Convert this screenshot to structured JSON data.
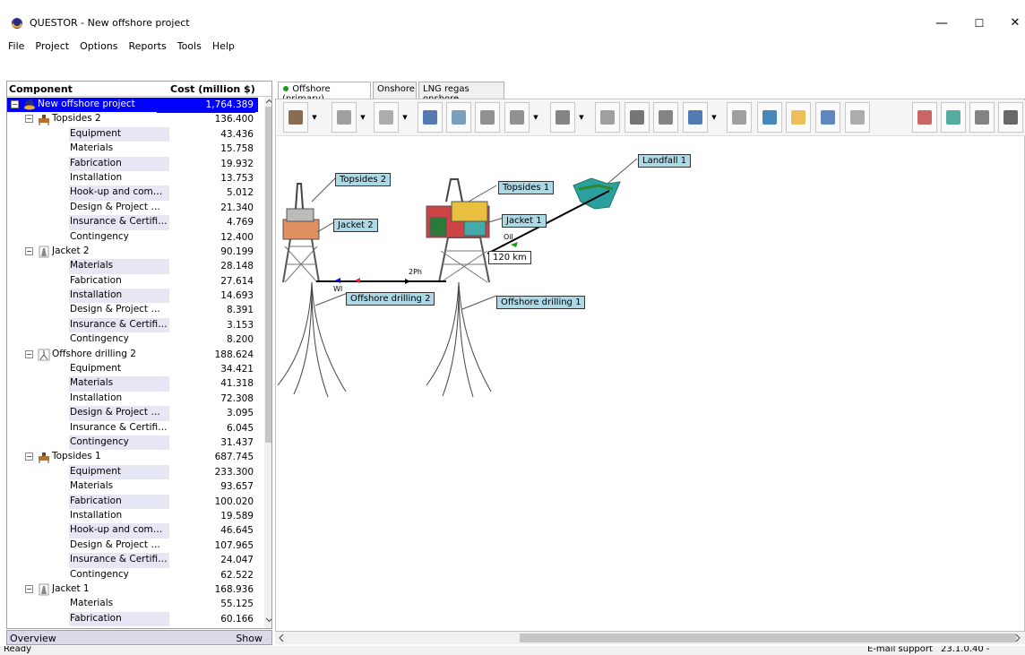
{
  "window": {
    "title": "QUESTOR - New offshore project",
    "minimize": "—",
    "maximize": "☐",
    "close": "✕"
  },
  "menu": [
    "File",
    "Project",
    "Options",
    "Reports",
    "Tools",
    "Help"
  ],
  "panel": {
    "col_component": "Component",
    "col_cost": "Cost (million $)",
    "rows": [
      {
        "name": "New offshore project",
        "cost": "1,764.389",
        "level": 0,
        "sel": true,
        "icon": "globe-icon",
        "exp": "−"
      },
      {
        "name": "Topsides 2",
        "cost": "136.400",
        "level": 1,
        "icon": "topsides-icon",
        "exp": "−"
      },
      {
        "name": "Equipment",
        "cost": "43.436",
        "level": 2,
        "alt": true
      },
      {
        "name": "Materials",
        "cost": "15.758",
        "level": 2
      },
      {
        "name": "Fabrication",
        "cost": "19.932",
        "level": 2,
        "alt": true
      },
      {
        "name": "Installation",
        "cost": "13.753",
        "level": 2
      },
      {
        "name": "Hook-up and commissi...",
        "cost": "5.012",
        "level": 2,
        "alt": true
      },
      {
        "name": "Design & Project man...",
        "cost": "21.340",
        "level": 2
      },
      {
        "name": "Insurance & Certificat...",
        "cost": "4.769",
        "level": 2,
        "alt": true
      },
      {
        "name": "Contingency",
        "cost": "12.400",
        "level": 2
      },
      {
        "name": "Jacket 2",
        "cost": "90.199",
        "level": 1,
        "icon": "jacket-icon",
        "exp": "−"
      },
      {
        "name": "Materials",
        "cost": "28.148",
        "level": 2,
        "alt": true
      },
      {
        "name": "Fabrication",
        "cost": "27.614",
        "level": 2
      },
      {
        "name": "Installation",
        "cost": "14.693",
        "level": 2,
        "alt": true
      },
      {
        "name": "Design & Project man...",
        "cost": "8.391",
        "level": 2
      },
      {
        "name": "Insurance & Certificat...",
        "cost": "3.153",
        "level": 2,
        "alt": true
      },
      {
        "name": "Contingency",
        "cost": "8.200",
        "level": 2
      },
      {
        "name": "Offshore drilling 2",
        "cost": "188.624",
        "level": 1,
        "icon": "drilling-icon",
        "exp": "−"
      },
      {
        "name": "Equipment",
        "cost": "34.421",
        "level": 2
      },
      {
        "name": "Materials",
        "cost": "41.318",
        "level": 2,
        "alt": true
      },
      {
        "name": "Installation",
        "cost": "72.308",
        "level": 2
      },
      {
        "name": "Design & Project man...",
        "cost": "3.095",
        "level": 2,
        "alt": true
      },
      {
        "name": "Insurance & Certificat...",
        "cost": "6.045",
        "level": 2
      },
      {
        "name": "Contingency",
        "cost": "31.437",
        "level": 2,
        "alt": true
      },
      {
        "name": "Topsides 1",
        "cost": "687.745",
        "level": 1,
        "icon": "topsides-icon",
        "exp": "−"
      },
      {
        "name": "Equipment",
        "cost": "233.300",
        "level": 2,
        "alt": true
      },
      {
        "name": "Materials",
        "cost": "93.657",
        "level": 2
      },
      {
        "name": "Fabrication",
        "cost": "100.020",
        "level": 2,
        "alt": true
      },
      {
        "name": "Installation",
        "cost": "19.589",
        "level": 2
      },
      {
        "name": "Hook-up and commissi...",
        "cost": "46.645",
        "level": 2,
        "alt": true
      },
      {
        "name": "Design & Project man...",
        "cost": "107.965",
        "level": 2
      },
      {
        "name": "Insurance & Certificat...",
        "cost": "24.047",
        "level": 2,
        "alt": true
      },
      {
        "name": "Contingency",
        "cost": "62.522",
        "level": 2
      },
      {
        "name": "Jacket 1",
        "cost": "168.936",
        "level": 1,
        "icon": "jacket-icon",
        "exp": "−"
      },
      {
        "name": "Materials",
        "cost": "55.125",
        "level": 2
      },
      {
        "name": "Fabrication",
        "cost": "60.166",
        "level": 2,
        "alt": true
      }
    ]
  },
  "overview": {
    "label": "Overview",
    "show": "Show"
  },
  "status": {
    "left": "Ready",
    "support": "E-mail support",
    "version": "23.1.0.40 - 16/05/202"
  },
  "tabs": [
    "Offshore (primary)",
    "Onshore",
    "LNG regas onshore"
  ],
  "diagram": {
    "topsides2": "Topsides 2",
    "jacket2": "Jacket 2",
    "topsides1": "Topsides 1",
    "jacket1": "Jacket 1",
    "landfall1": "Landfall 1",
    "drilling2": "Offshore drilling 2",
    "drilling1": "Offshore drilling 1",
    "pipeline_length": "120 km",
    "oil": "Oil",
    "twoph": "2Ph",
    "wi": "WI"
  },
  "colors": {
    "label_bg": "#add8e6",
    "selection": "#0000ff",
    "alt_row": "#e6e6f5"
  }
}
